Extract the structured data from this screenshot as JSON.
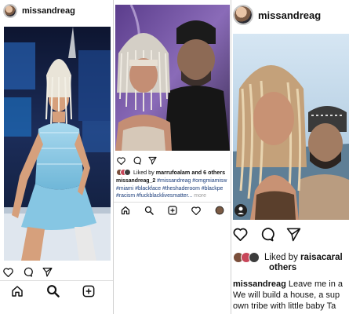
{
  "panel1": {
    "username": "missandreag",
    "nav": [
      "home-icon",
      "search-icon",
      "add-post-icon"
    ]
  },
  "panel2": {
    "liked_prefix": "Liked by ",
    "liked_user": "marrufoalam",
    "liked_suffix": " and 6 others",
    "caption_user": "missandreag_2",
    "caption_line1": "#missandreag #omgmiamisw",
    "caption_line2": "#miami #blackface #theshaderoom #blackpe",
    "caption_line3": "#racism #fuckblacklivesmatter...",
    "more": "more",
    "nav": [
      "home-icon",
      "search-icon",
      "add-post-icon",
      "heart-icon",
      "profile-icon"
    ]
  },
  "panel3": {
    "username": "missandreag",
    "liked_prefix": "Liked by ",
    "liked_user": "raisacaral",
    "liked_line2": "others",
    "caption_user": "missandreag",
    "caption_text": " Leave me in a",
    "caption_line2": "We will build a house, a sup",
    "caption_line3": "own tribe with little baby Ta"
  },
  "colors": {
    "link": "#1b3d7a",
    "border": "#cfcfcf"
  }
}
